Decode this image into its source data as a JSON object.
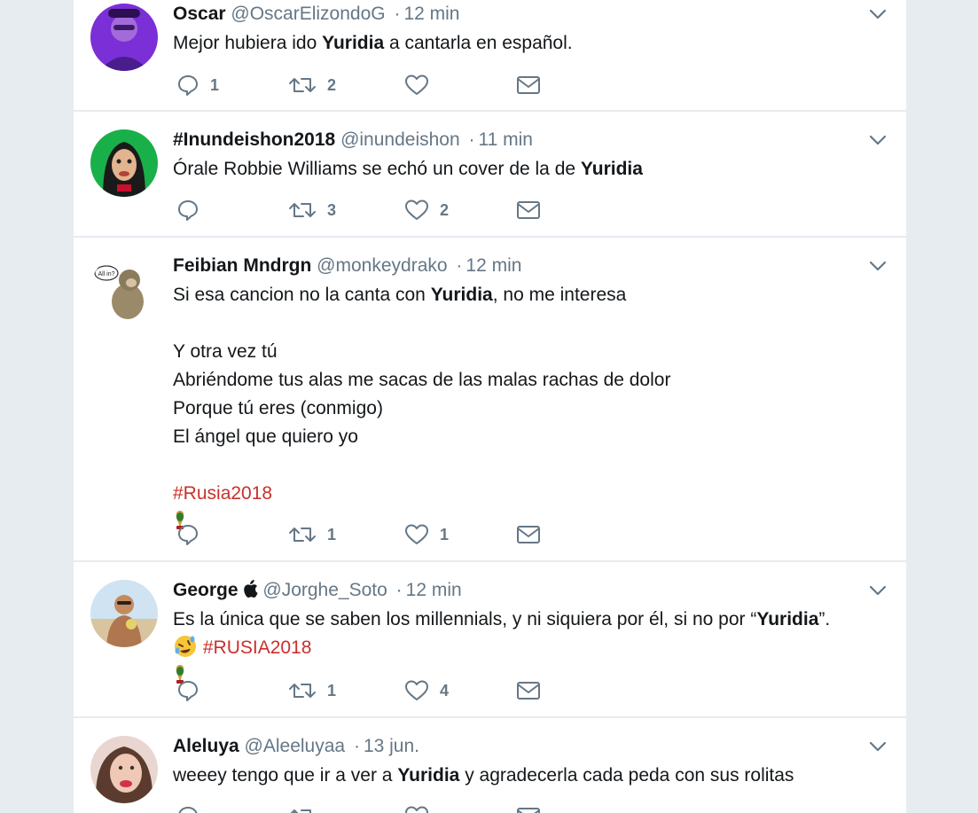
{
  "tweets": [
    {
      "name": "Oscar",
      "handle": "@OscarElizondoG",
      "sep": "·",
      "time": "12 min",
      "text_pre": "Mejor hubiera ido ",
      "text_bold": "Yuridia",
      "text_post": " a cantarla en español.",
      "replies": "1",
      "retweets": "2",
      "likes": ""
    },
    {
      "name": "#Inundeishon2018",
      "handle": "@inundeishon",
      "sep": "·",
      "time": "11 min",
      "text_pre": "Órale Robbie Williams se echó un cover de la de ",
      "text_bold": "Yuridia",
      "text_post": "",
      "replies": "",
      "retweets": "3",
      "likes": "2"
    },
    {
      "name": "Feibian Mndrgn",
      "handle": "@monkeydrako",
      "sep": "·",
      "time": "12 min",
      "text_pre": "Si esa cancion no la canta con ",
      "text_bold": "Yuridia",
      "text_post": ", no me interesa",
      "text_body": "Y otra vez tú\nAbriéndome tus alas me sacas de las malas rachas de dolor\nPorque tú eres (conmigo)\nEl ángel que quiero yo",
      "hashtag": "#Rusia2018",
      "replies": "",
      "retweets": "1",
      "likes": "1"
    },
    {
      "name": "George",
      "handle": "@Jorghe_Soto",
      "sep": "·",
      "time": "12 min",
      "text_pre": "Es la única que se saben los millennials, y ni siquiera por él, si no por “",
      "text_bold": "Yuridia",
      "text_post": "”.",
      "hashtag": "#RUSIA2018",
      "replies": "",
      "retweets": "1",
      "likes": "4"
    },
    {
      "name": "Aleluya",
      "handle": "@Aleeluyaa",
      "sep": "·",
      "time": "13 jun.",
      "text_pre": "weeey tengo que ir a ver a ",
      "text_bold": "Yuridia",
      "text_post": " y agradecerla cada peda con sus rolitas",
      "replies": "",
      "retweets": "",
      "likes": ""
    }
  ],
  "colors": {
    "background": "#e6ecf0",
    "card": "#ffffff",
    "text": "#14171a",
    "secondary": "#657786",
    "hashtag": "#c9302c"
  },
  "icons": [
    "reply-icon",
    "retweet-icon",
    "like-icon",
    "direct-message-icon",
    "chevron-down-icon",
    "apple-icon",
    "trophy-icon",
    "rolling-laughing-emoji"
  ]
}
